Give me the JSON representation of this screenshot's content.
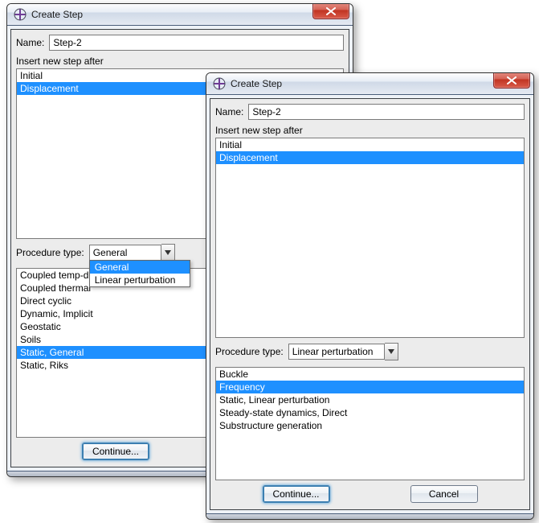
{
  "win1": {
    "title": "Create Step",
    "name_label": "Name:",
    "name_value": "Step-2",
    "insert_label": "Insert new step after",
    "steps": [
      "Initial",
      "Displacement"
    ],
    "steps_selected_index": 1,
    "proc_type_label": "Procedure type:",
    "proc_type_value": "General",
    "proc_type_options": [
      "General",
      "Linear perturbation"
    ],
    "proc_type_options_selected_index": 0,
    "procedures": [
      "Coupled temp-displacement",
      "Coupled thermal-electrical",
      "Direct cyclic",
      "Dynamic, Implicit",
      "Geostatic",
      "Soils",
      "Static, General",
      "Static, Riks"
    ],
    "procedures_selected_index": 6,
    "continue_label": "Continue..."
  },
  "win2": {
    "title": "Create Step",
    "name_label": "Name:",
    "name_value": "Step-2",
    "insert_label": "Insert new step after",
    "steps": [
      "Initial",
      "Displacement"
    ],
    "steps_selected_index": 1,
    "proc_type_label": "Procedure type:",
    "proc_type_value": "Linear perturbation",
    "procedures": [
      "Buckle",
      "Frequency",
      "Static, Linear perturbation",
      "Steady-state dynamics, Direct",
      "Substructure generation"
    ],
    "procedures_selected_index": 1,
    "continue_label": "Continue...",
    "cancel_label": "Cancel"
  }
}
